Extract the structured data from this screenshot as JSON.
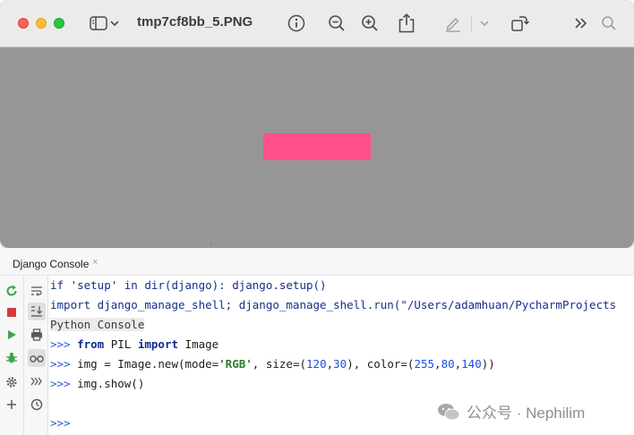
{
  "preview": {
    "file_name": "tmp7cf8bb_5.PNG",
    "image_fill_color": "#ff5089",
    "canvas_color": "#969696"
  },
  "toolbar_icons": [
    "sidebar-icon",
    "chevron-down-icon",
    "info-icon",
    "zoom-out-icon",
    "zoom-in-icon",
    "share-icon",
    "markup-pen-icon",
    "chevron-down-icon",
    "rotate-icon",
    "more-icon",
    "search-icon"
  ],
  "console": {
    "tab_label": "Django Console",
    "tab_close": "×",
    "lines": {
      "l1": "if 'setup' in dir(django): django.setup()",
      "l2": "import django_manage_shell; django_manage_shell.run(\"/Users/adamhuan/PycharmProjects",
      "l3": "Python Console",
      "l4_prompt": ">>>",
      "l4_from": "from",
      "l4_mid": " PIL ",
      "l4_import": "import",
      "l4_end": " Image",
      "l5_prompt": ">>>",
      "l5_a": " img = Image.new(mode=",
      "l5_str": "'RGB'",
      "l5_b": ", size=(",
      "l5_n1": "120",
      "l5_c1": ",",
      "l5_n2": "30",
      "l5_c": "), color=(",
      "l5_n3": "255",
      "l5_c2": ",",
      "l5_n4": "80",
      "l5_c3": ",",
      "l5_n5": "140",
      "l5_end": "))",
      "l6_prompt": ">>>",
      "l6": " img.show()",
      "l7_prompt": ">>>"
    }
  },
  "watermark": {
    "text": "公众号 · Nephilim"
  },
  "colors": {
    "prompt": "#2a5bd7",
    "keyword": "#0b2d8f",
    "string": "#2b7d2b",
    "number": "#1d4fe0"
  }
}
